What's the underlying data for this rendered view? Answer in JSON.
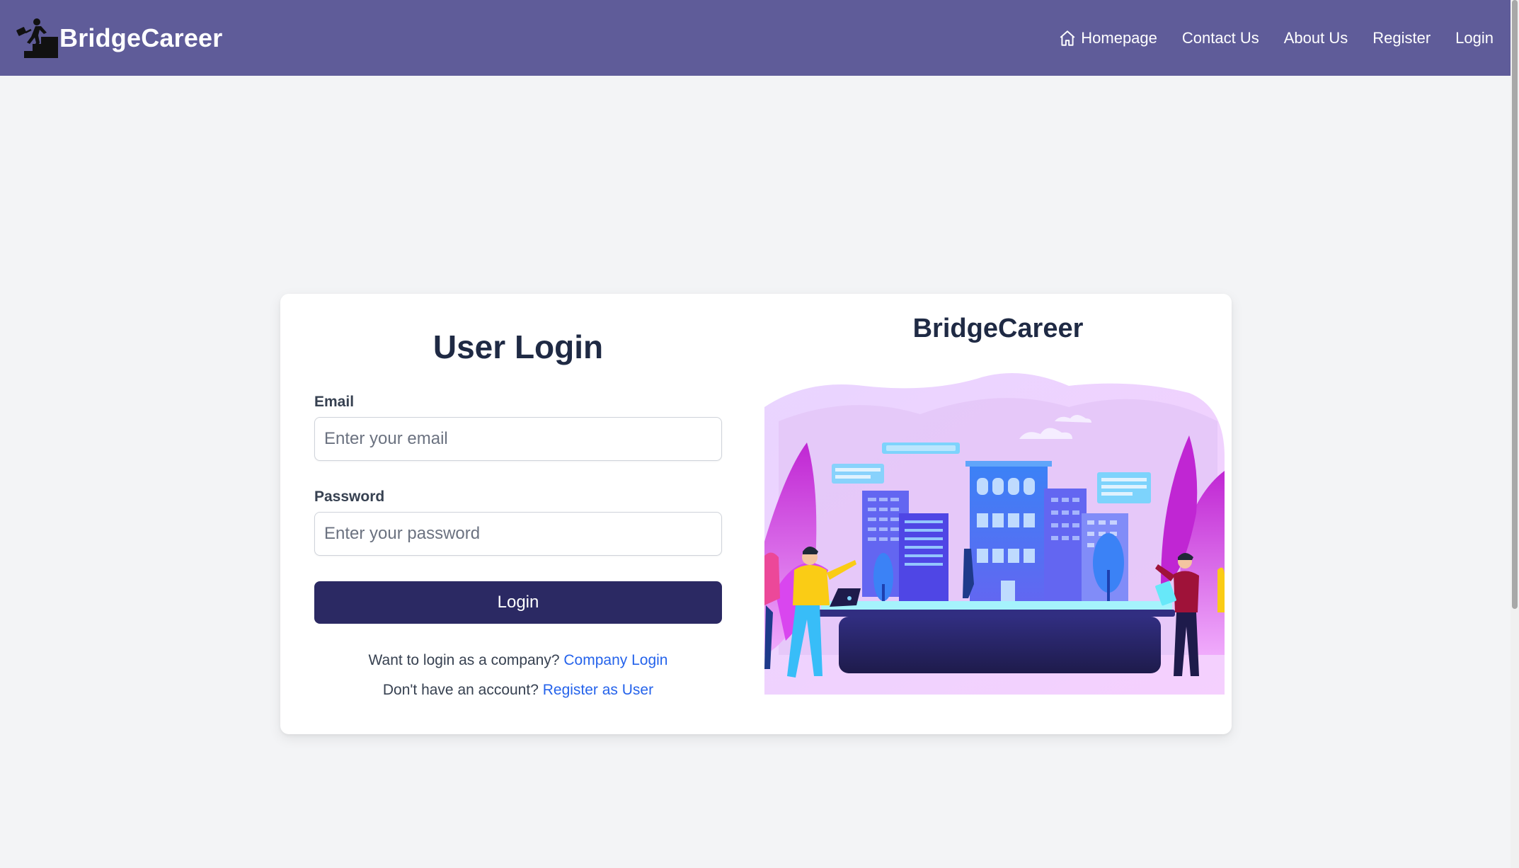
{
  "navbar": {
    "brand": "BridgeCareer",
    "links": [
      {
        "label": "Homepage",
        "icon": "home-icon"
      },
      {
        "label": "Contact Us"
      },
      {
        "label": "About Us"
      },
      {
        "label": "Register"
      },
      {
        "label": "Login"
      }
    ],
    "background": "#5f5c99"
  },
  "login": {
    "title": "User Login",
    "email_label": "Email",
    "email_placeholder": "Enter your email",
    "password_label": "Password",
    "password_placeholder": "Enter your password",
    "button_label": "Login",
    "company_prompt": "Want to login as a company?",
    "company_link": "Company Login",
    "register_prompt": "Don't have an account?",
    "register_link": "Register as User",
    "button_color": "#2b2963",
    "link_color": "#2563eb"
  },
  "showcase": {
    "title": "BridgeCareer",
    "illustration": "city-buildings-people-illustration"
  }
}
